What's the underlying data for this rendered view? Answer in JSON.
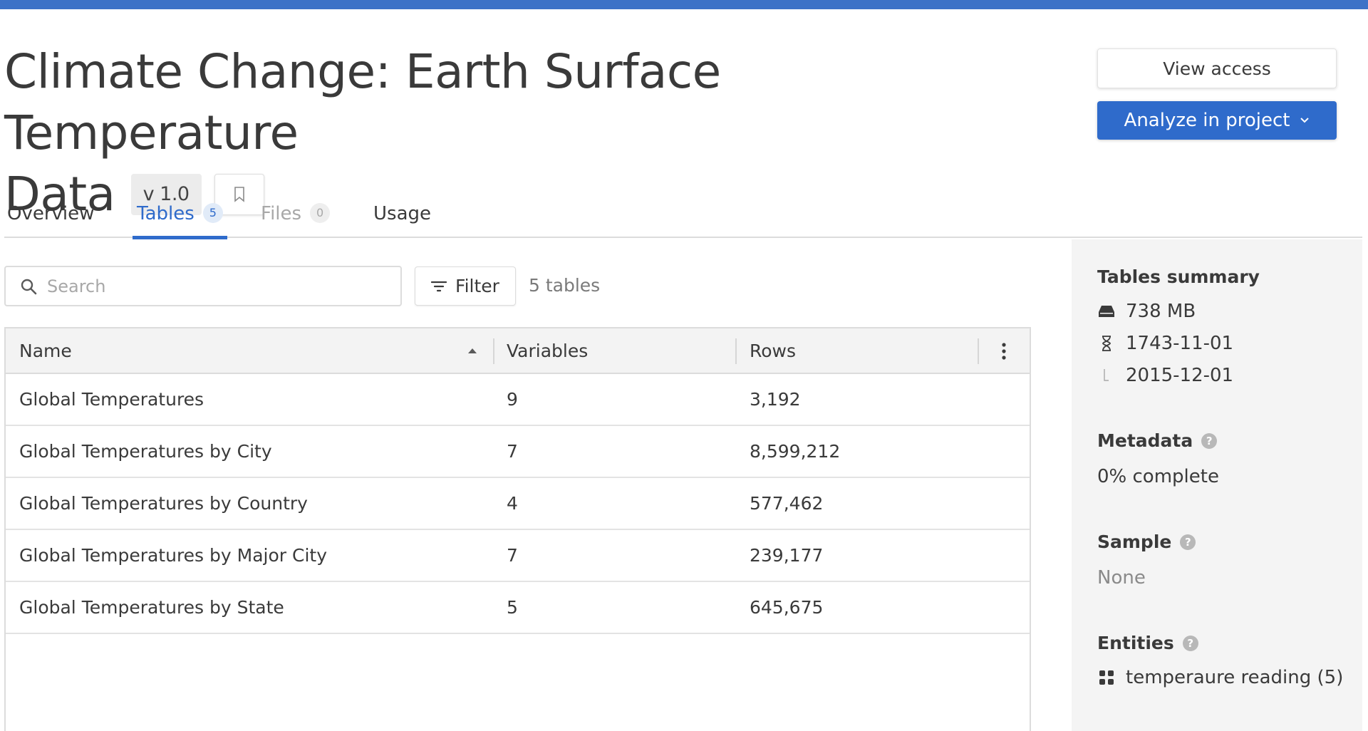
{
  "header": {
    "title_line1": "Climate Change: Earth Surface Temperature",
    "title_line2": "Data",
    "version": "v 1.0",
    "view_access_label": "View access",
    "analyze_label": "Analyze in project"
  },
  "tabs": [
    {
      "label": "Overview",
      "count": ""
    },
    {
      "label": "Tables",
      "count": "5"
    },
    {
      "label": "Files",
      "count": "0"
    },
    {
      "label": "Usage",
      "count": ""
    }
  ],
  "toolbar": {
    "search_placeholder": "Search",
    "search_value": "",
    "filter_label": "Filter",
    "count_text": "5 tables"
  },
  "table": {
    "columns": [
      "Name",
      "Variables",
      "Rows"
    ],
    "rows": [
      {
        "name": "Global Temperatures",
        "variables": "9",
        "rows": "3,192"
      },
      {
        "name": "Global Temperatures by City",
        "variables": "7",
        "rows": "8,599,212"
      },
      {
        "name": "Global Temperatures by Country",
        "variables": "4",
        "rows": "577,462"
      },
      {
        "name": "Global Temperatures by Major City",
        "variables": "7",
        "rows": "239,177"
      },
      {
        "name": "Global Temperatures by State",
        "variables": "5",
        "rows": "645,675"
      }
    ]
  },
  "summary": {
    "title": "Tables summary",
    "size": "738 MB",
    "start_date": "1743-11-01",
    "end_date": "2015-12-01",
    "metadata_title": "Metadata",
    "metadata_value": "0% complete",
    "sample_title": "Sample",
    "sample_value": "None",
    "entities_title": "Entities",
    "entities_value": "temperaure reading (5)"
  },
  "colors": {
    "accent": "#2f6bcb",
    "top_bar": "#3d72c7",
    "panel_bg": "#f4f4f4"
  },
  "icons": [
    "bookmark-icon",
    "chevron-down-icon",
    "search-icon",
    "filter-icon",
    "sort-asc-icon",
    "kebab-menu-icon",
    "storage-icon",
    "hourglass-icon",
    "end-date-icon",
    "help-icon",
    "entities-grid-icon"
  ]
}
